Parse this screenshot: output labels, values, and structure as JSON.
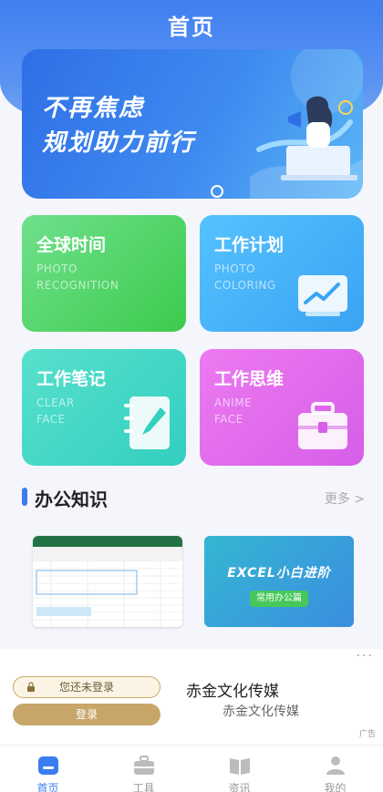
{
  "header": {
    "title": "首页"
  },
  "banner": {
    "line1": "不再焦虑",
    "line2": "规划助力前行"
  },
  "cards": [
    {
      "title": "全球时间",
      "sub1": "PHOTO",
      "sub2": "RECOGNITION"
    },
    {
      "title": "工作计划",
      "sub1": "PHOTO",
      "sub2": "COLORING"
    },
    {
      "title": "工作笔记",
      "sub1": "CLEAR",
      "sub2": "FACE"
    },
    {
      "title": "工作思维",
      "sub1": "ANIME",
      "sub2": "FACE"
    }
  ],
  "section": {
    "title": "办公知识",
    "more": "更多 >"
  },
  "articles": [
    {
      "kind": "spreadsheet-screenshot"
    },
    {
      "title": "EXCEL小白进阶",
      "tag": "常用办公篇"
    }
  ],
  "ad": {
    "login_hint": "您还未登录",
    "login_button": "登录",
    "name": "赤金文化传媒",
    "subname": "赤金文化传媒",
    "more": "···",
    "label": "广告"
  },
  "tabs": [
    {
      "label": "首页",
      "icon": "home-icon",
      "active": true
    },
    {
      "label": "工具",
      "icon": "briefcase-icon",
      "active": false
    },
    {
      "label": "资讯",
      "icon": "book-icon",
      "active": false
    },
    {
      "label": "我的",
      "icon": "user-icon",
      "active": false
    }
  ],
  "colors": {
    "primary": "#3b7cf0",
    "green": "#3ccb4d",
    "blue": "#3aa3f3",
    "teal": "#33cfbf",
    "purple": "#d65ee9",
    "gold": "#c8a66a"
  }
}
